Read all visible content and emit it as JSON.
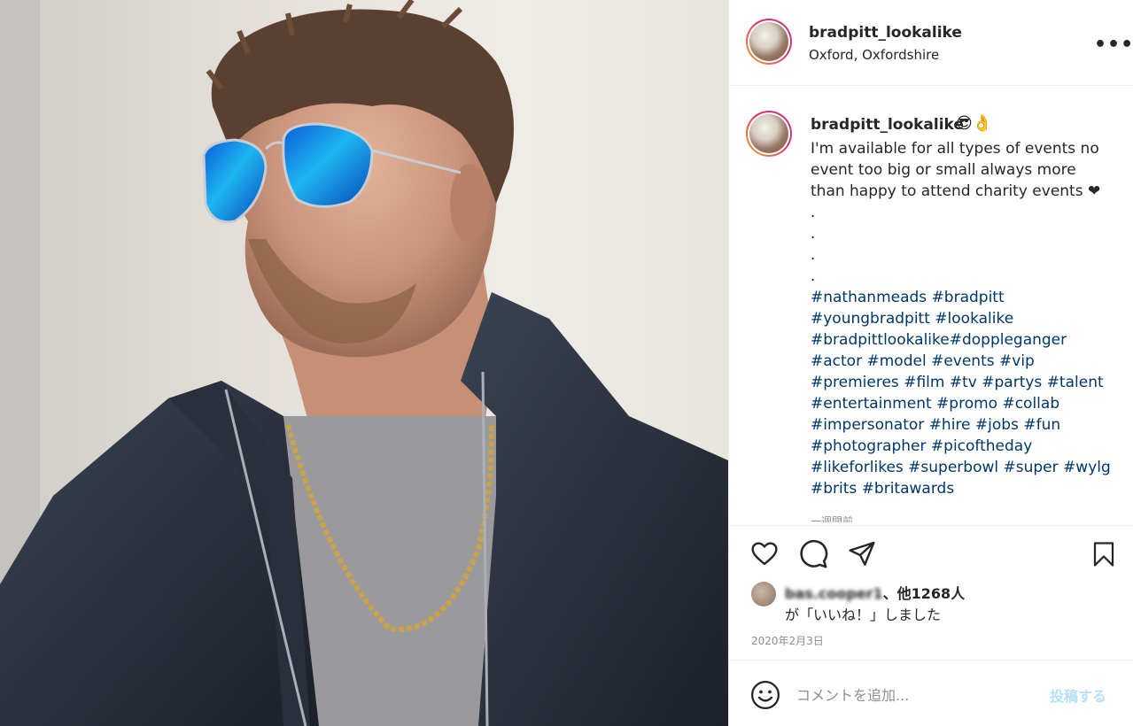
{
  "post": {
    "username": "bradpitt_lookalike",
    "location": "Oxford, Oxfordshire",
    "more_icon": "•••"
  },
  "caption": {
    "username": "bradpitt_lookalike",
    "emoji": "😎👌",
    "text": "I'm available for all types of events no event too big or small always more than happy to attend charity events ❤\n.\n.\n.\n.",
    "hashtag_lines": [
      [
        "#nathanmeads",
        "#bradpitt"
      ],
      [
        "#youngbradpitt",
        "#lookalike"
      ],
      [
        "#bradpittlookalike#doppleganger"
      ],
      [
        "#actor",
        "#model",
        "#events",
        "#vip"
      ],
      [
        "#premieres",
        "#film",
        "#tv",
        "#partys",
        "#talent"
      ],
      [
        "#entertainment",
        "#promo",
        "#collab"
      ],
      [
        "#impersonator",
        "#hire",
        "#jobs",
        "#fun"
      ],
      [
        "#photographer",
        "#picoftheday"
      ],
      [
        "#likeforlikes",
        "#superbowl",
        "#super",
        "#wylg"
      ],
      [
        "#brits",
        "#britawards"
      ]
    ],
    "truncated_label": "一週間前"
  },
  "likes": {
    "liker_name": "bas.cooper1",
    "line1_suffix": "、他1268人",
    "line2": "が「いいね！」しました"
  },
  "date": "2020年2月3日",
  "comment": {
    "placeholder": "コメントを追加...",
    "post_label": "投稿する"
  },
  "icons": {
    "like": "heart-icon",
    "comment": "comment-icon",
    "share": "paper-plane-icon",
    "save": "bookmark-icon",
    "emoji": "smiley-icon"
  },
  "colors": {
    "hashtag": "#00376b",
    "post_button_disabled": "#b2dffc",
    "muted": "#8e8e8e"
  }
}
